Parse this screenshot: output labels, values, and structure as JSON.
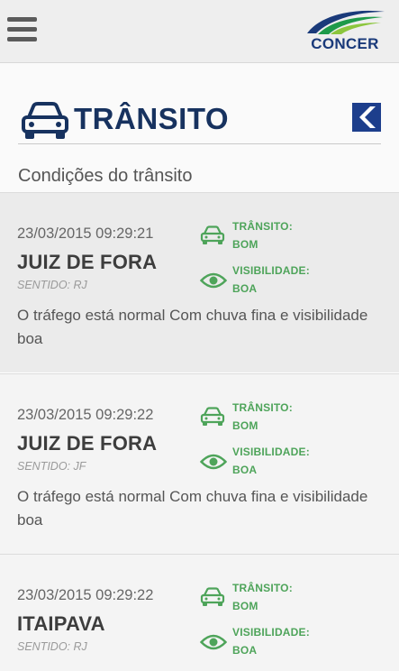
{
  "app": {
    "logo_text": "CONCER"
  },
  "header": {
    "title": "TRÂNSITO",
    "subtitle": "Condições do trânsito"
  },
  "colors": {
    "title": "#17325f",
    "status_green": "#4ea45a",
    "logo_blue": "#1a3a7a",
    "logo_green": "#1e9a4a",
    "back_button": "#1d3e8c"
  },
  "icons": {
    "menu": "hamburger-menu-icon",
    "header_car": "car-icon",
    "back": "back-arrow-icon",
    "traffic": "car-icon",
    "visibility": "eye-icon"
  },
  "cards": [
    {
      "datetime": "23/03/2015 09:29:21",
      "city": "JUIZ DE FORA",
      "direction": "SENTIDO: RJ",
      "traffic_label": "TRÂNSITO:",
      "traffic_value": "BOM",
      "visibility_label": "VISIBILIDADE:",
      "visibility_value": "BOA",
      "description": "O tráfego está normal Com chuva fina e visibilidade boa"
    },
    {
      "datetime": "23/03/2015 09:29:22",
      "city": "JUIZ DE FORA",
      "direction": "SENTIDO: JF",
      "traffic_label": "TRÂNSITO:",
      "traffic_value": "BOM",
      "visibility_label": "VISIBILIDADE:",
      "visibility_value": "BOA",
      "description": "O tráfego está normal Com chuva fina e visibilidade boa"
    },
    {
      "datetime": "23/03/2015 09:29:22",
      "city": "ITAIPAVA",
      "direction": "SENTIDO: RJ",
      "traffic_label": "TRÂNSITO:",
      "traffic_value": "BOM",
      "visibility_label": "VISIBILIDADE:",
      "visibility_value": "BOA",
      "description": ""
    }
  ]
}
